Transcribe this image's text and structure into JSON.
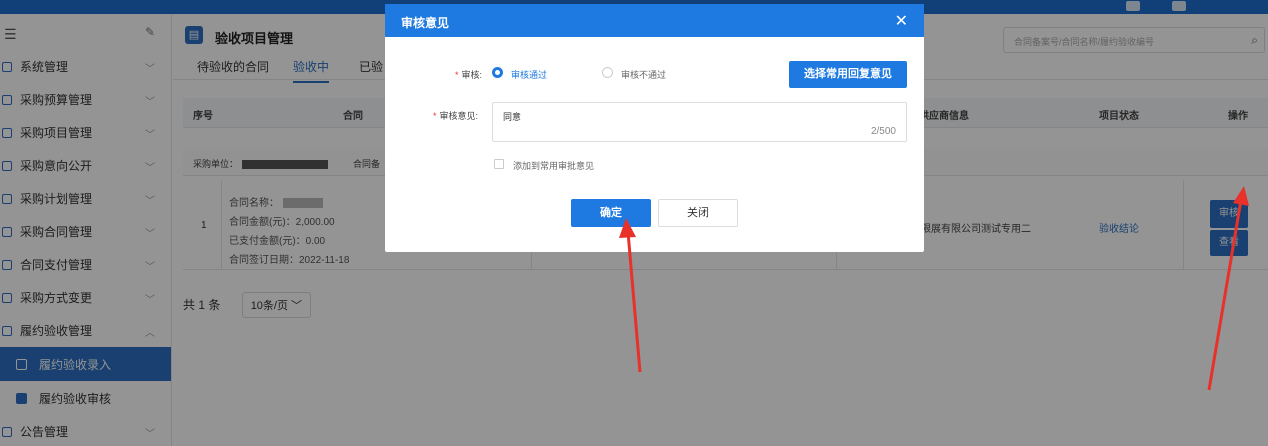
{
  "sidebar": {
    "items": [
      {
        "label": "系统管理"
      },
      {
        "label": "采购预算管理"
      },
      {
        "label": "采购项目管理"
      },
      {
        "label": "采购意向公开"
      },
      {
        "label": "采购计划管理"
      },
      {
        "label": "采购合同管理"
      },
      {
        "label": "合同支付管理"
      },
      {
        "label": "采购方式变更"
      },
      {
        "label": "履约验收管理"
      }
    ],
    "subitems": [
      {
        "label": "履约验收录入"
      },
      {
        "label": "履约验收审核"
      }
    ],
    "last_item": {
      "label": "公告管理"
    }
  },
  "page": {
    "title": "验收项目管理",
    "search_placeholder": "合同备案号/合同名称/履约验收编号"
  },
  "tabs": [
    {
      "label": "待验收的合同"
    },
    {
      "label": "验收中"
    },
    {
      "label": "已验"
    }
  ],
  "table": {
    "headers": {
      "seq": "序号",
      "contract": "合同",
      "supplier": "供应商信息",
      "status": "项目状态",
      "actions": "操作"
    },
    "group": {
      "unit_label": "采购单位：",
      "contract_label": "合同备"
    },
    "row": {
      "index": "1",
      "name_label": "合同名称：",
      "amount": "合同金额(元)：2,000.00",
      "paid": "已支付金额(元)：0.00",
      "sign_date": "合同签订日期：2022-11-18",
      "supplier": "限展有限公司测试专用二",
      "status": "验收结论",
      "review_btn": "审核",
      "view_btn": "查看"
    }
  },
  "pager": {
    "total": "共 1 条",
    "page_size": "10条/页"
  },
  "dialog": {
    "title": "审核意见",
    "audit_label": "审核:",
    "option_pass": "审核通过",
    "option_fail": "审核不通过",
    "quick_reply_btn": "选择常用回复意见",
    "opinion_label": "审核意见:",
    "opinion_value": "同意",
    "counter": "2/500",
    "add_common": "添加到常用审批意见",
    "confirm": "确定",
    "close": "关闭"
  }
}
